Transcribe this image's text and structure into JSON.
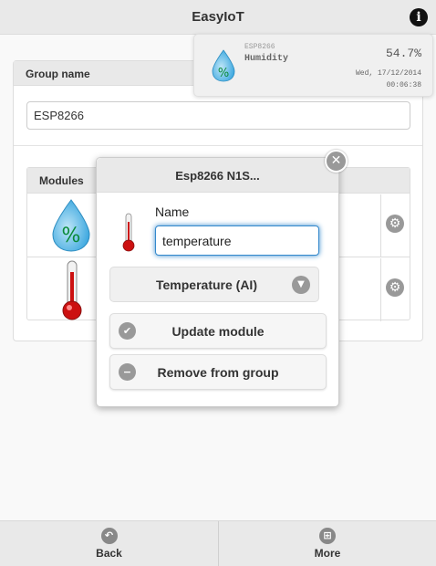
{
  "header": {
    "title": "EasyIoT",
    "info_glyph": "i"
  },
  "notification": {
    "device": "ESP8266",
    "name": "Humidity",
    "value": "54.7%",
    "date": "Wed, 17/12/2014",
    "time": "00:06:38",
    "icon": "humidity-drop-icon"
  },
  "group": {
    "name_label": "Group name",
    "name_value": "ESP8266",
    "modules_label": "Modules",
    "modules": [
      {
        "icon": "humidity-drop-icon"
      },
      {
        "icon": "thermometer-icon"
      }
    ]
  },
  "dialog": {
    "title": "Esp8266 N1S...",
    "name_label": "Name",
    "name_value": "temperature",
    "type_value": "Temperature (AI)",
    "update_label": "Update module",
    "remove_label": "Remove from group"
  },
  "footer": {
    "back_label": "Back",
    "more_label": "More"
  },
  "colors": {
    "accent_focus": "#3388cc",
    "icon_gray": "#999999",
    "thermo_red": "#cc1111",
    "drop_blue": "#3fa9e0"
  }
}
